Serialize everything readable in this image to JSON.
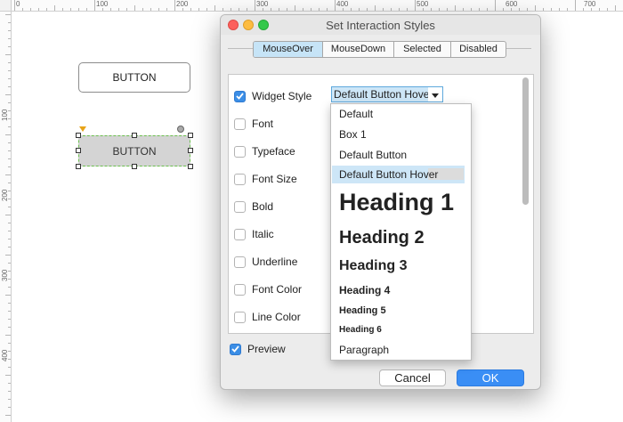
{
  "ruler": {
    "top_labels": [
      "0",
      "100",
      "200",
      "300",
      "400",
      "500",
      "600",
      "700"
    ],
    "left_labels": [
      "100",
      "200",
      "300",
      "400"
    ]
  },
  "canvas": {
    "button1_label": "BUTTON",
    "button2_label": "BUTTON"
  },
  "dialog": {
    "title": "Set Interaction Styles",
    "tabs": [
      {
        "label": "MouseOver",
        "active": true
      },
      {
        "label": "MouseDown",
        "active": false
      },
      {
        "label": "Selected",
        "active": false
      },
      {
        "label": "Disabled",
        "active": false
      }
    ],
    "options": [
      {
        "label": "Widget Style",
        "checked": true
      },
      {
        "label": "Font",
        "checked": false
      },
      {
        "label": "Typeface",
        "checked": false
      },
      {
        "label": "Font Size",
        "checked": false
      },
      {
        "label": "Bold",
        "checked": false
      },
      {
        "label": "Italic",
        "checked": false
      },
      {
        "label": "Underline",
        "checked": false
      },
      {
        "label": "Font Color",
        "checked": false
      },
      {
        "label": "Line Color",
        "checked": false
      }
    ],
    "widget_style_value": "Default Button Hove",
    "preview_label": "Preview",
    "preview_checked": true,
    "cancel_label": "Cancel",
    "ok_label": "OK"
  },
  "dropdown": {
    "items": [
      "Default",
      "Box 1",
      "Default Button",
      "Default Button Hover",
      "Heading 1",
      "Heading 2",
      "Heading 3",
      "Heading 4",
      "Heading 5",
      "Heading 6",
      "Paragraph"
    ],
    "selected": "Default Button Hover"
  },
  "colors": {
    "accent": "#3a8ef5",
    "tab_active": "#c6e4f7",
    "selection": "#cde6f7",
    "canvas_selection_border": "#6bbf4e"
  }
}
